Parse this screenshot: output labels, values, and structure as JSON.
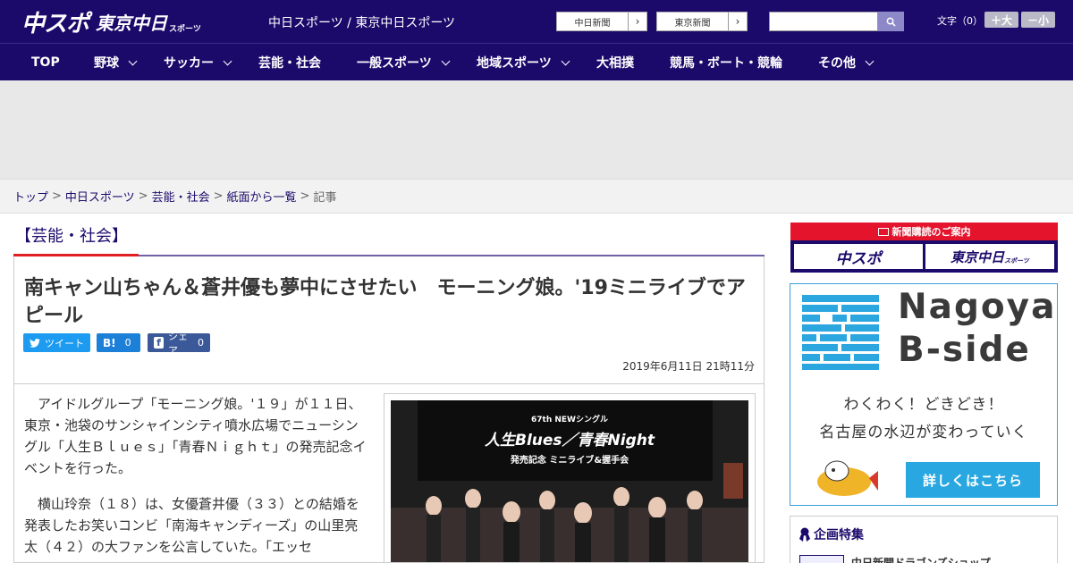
{
  "header": {
    "logo_main": "中スポ",
    "logo_sub": "東京中日",
    "logo_small": "スポーツ",
    "site_name": "中日スポーツ / 東京中日スポーツ",
    "ext_links": [
      "中日新聞",
      "東京新聞"
    ],
    "search_placeholder": "",
    "font_label": "文字（0）",
    "font_bigger": "＋大",
    "font_smaller": "－小",
    "brand_color": "#1c0a6b"
  },
  "nav": {
    "items": [
      {
        "label": "TOP"
      },
      {
        "label": "野球"
      },
      {
        "label": "サッカー"
      },
      {
        "label": "芸能・社会"
      },
      {
        "label": "一般スポーツ"
      },
      {
        "label": "地域スポーツ"
      },
      {
        "label": "大相撲"
      },
      {
        "label": "競馬・ボート・競輪"
      },
      {
        "label": "その他"
      }
    ]
  },
  "breadcrumb": {
    "items": [
      "トップ",
      "中日スポーツ",
      "芸能・社会",
      "紙面から一覧"
    ],
    "current": "記事",
    "separator": ">"
  },
  "article": {
    "category": "【芸能・社会】",
    "title": "南キャン山ちゃん＆蒼井優も夢中にさせたい　モーニング娘。'19ミニライブでアピール",
    "share": {
      "tweet": "ツイート",
      "hatena_count": "0",
      "hatena_label": "B!",
      "fb_label": "シェア",
      "fb_count": "0"
    },
    "date": "2019年6月11日 21時11分",
    "paragraphs": [
      "　アイドルグループ「モーニング娘。'１９」が１１日、東京・池袋のサンシャインシティ噴水広場でニューシングル「人生Ｂｌｕｅｓ」「青春Ｎｉｇｈｔ」の発売記念イベントを行った。",
      "　横山玲奈（１８）は、女優蒼井優（３３）との結婚を発表したお笑いコンビ「南海キャンディーズ」の山里亮太（４２）の大ファンを公言していた。「エッセ"
    ],
    "photo": {
      "sign_line1": "67th NEWシングル",
      "sign_line2": "人生Blues／青春Night",
      "sign_line3": "発売記念 ミニライブ&握手会"
    }
  },
  "sidebar": {
    "subscribe_title": "新聞購読のご案内",
    "subscribe_logo1": "中スポ",
    "subscribe_logo2": "東京中日",
    "subscribe_logo2_small": "スポーツ",
    "bside_title1": "Nagoya",
    "bside_title2": "B-side",
    "bside_line1": "わくわく！どきどき！",
    "bside_line2": "名古屋の水辺が変わっていく",
    "bside_button": "詳しくはこちら",
    "feature_title": "企画特集",
    "feature_item": "中日新聞ドラゴンズショップ"
  }
}
